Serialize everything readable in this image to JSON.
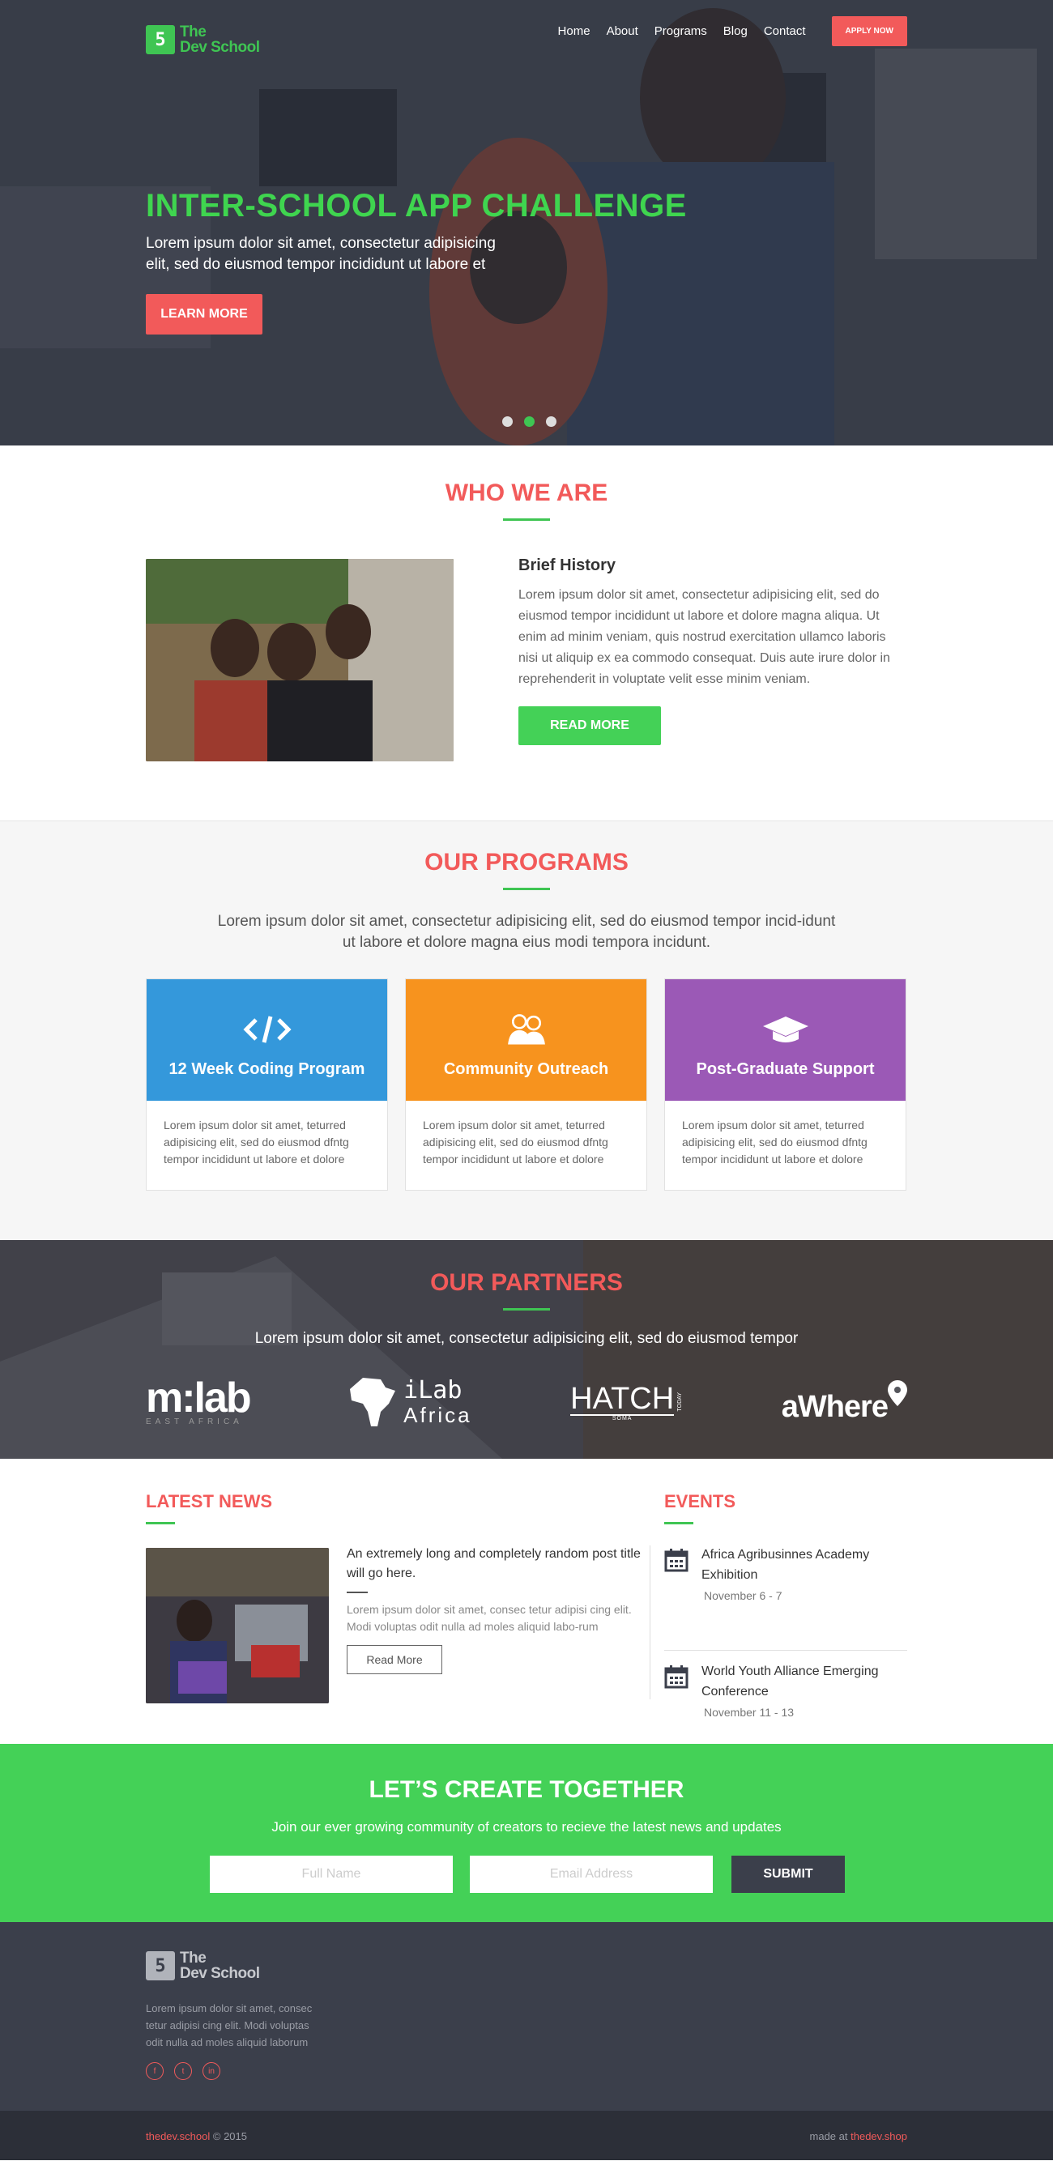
{
  "brand": {
    "line1": "The",
    "line2": "Dev School",
    "glyph": "5"
  },
  "nav": {
    "items": [
      "Home",
      "About",
      "Programs",
      "Blog",
      "Contact"
    ],
    "apply": "APPLY NOW"
  },
  "hero": {
    "title": "INTER-SCHOOL APP CHALLENGE",
    "subtitle": "Lorem ipsum dolor sit amet, consectetur adipisicing elit, sed do eiusmod tempor incididunt ut labore et",
    "button": "LEARN MORE",
    "slides": 3,
    "active_slide": 2
  },
  "who": {
    "title": "WHO WE ARE",
    "heading": "Brief History",
    "body": "Lorem ipsum dolor sit amet, consectetur adipisicing elit, sed do eiusmod tempor incididunt ut labore et dolore magna aliqua. Ut enim ad minim veniam, quis nostrud exercitation ullamco laboris nisi ut aliquip ex ea commodo consequat. Duis aute irure dolor in reprehenderit in voluptate velit esse minim veniam.",
    "button": "READ MORE"
  },
  "programs": {
    "title": "OUR PROGRAMS",
    "intro": "Lorem ipsum dolor sit amet, consectetur adipisicing elit, sed do eiusmod tempor incid-idunt ut labore et dolore magna eius modi tempora incidunt.",
    "cards": [
      {
        "title": "12 Week Coding Program",
        "icon": "code-icon",
        "color": "#3498db",
        "body": "Lorem ipsum dolor sit amet, teturred adipisicing elit, sed do eiusmod  dfntg tempor incididunt ut labore et dolore"
      },
      {
        "title": "Community Outreach",
        "icon": "people-icon",
        "color": "#f7931e",
        "body": "Lorem ipsum dolor sit amet, teturred adipisicing elit, sed do eiusmod  dfntg tempor incididunt ut labore et dolore"
      },
      {
        "title": "Post-Graduate Support",
        "icon": "graduation-cap-icon",
        "color": "#9b59b6",
        "body": "Lorem ipsum dolor sit amet, teturred adipisicing elit, sed do eiusmod  dfntg tempor incididunt ut labore et dolore"
      }
    ]
  },
  "partners": {
    "title": "OUR PARTNERS",
    "intro": "Lorem ipsum dolor sit amet, consectetur adipisicing elit, sed do eiusmod tempor",
    "logos": [
      {
        "name": "m:lab",
        "sub": "EAST AFRICA"
      },
      {
        "name": "iLab",
        "sub": "Africa"
      },
      {
        "name": "HATCH",
        "sub": "SOMA",
        "side": "TODAY"
      },
      {
        "name": "aWhere"
      }
    ]
  },
  "news": {
    "title": "LATEST NEWS",
    "post_title": "An extremely long and completely random post title will go here.",
    "post_body": "Lorem ipsum dolor sit amet, consec tetur adipisi cing elit. Modi voluptas odit nulla ad moles aliquid labo-rum",
    "button": "Read More"
  },
  "events": {
    "title": "EVENTS",
    "items": [
      {
        "name": "Africa Agribusinnes Academy Exhibition",
        "date": "November 6 - 7"
      },
      {
        "name": "World Youth Alliance Emerging Conference",
        "date": "November 11 - 13"
      }
    ]
  },
  "cta": {
    "title": "LET’S CREATE TOGETHER",
    "subtitle": "Join our ever growing community of creators to recieve the latest news and updates",
    "name_placeholder": "Full Name",
    "email_placeholder": "Email Address",
    "submit": "SUBMIT"
  },
  "footer": {
    "about": "Lorem ipsum dolor sit amet, consec tetur adipisi cing elit. Modi voluptas odit nulla ad moles aliquid laborum",
    "socials": [
      "f",
      "t",
      "in"
    ],
    "site": "thedev.school",
    "year": "© 2015",
    "made_at": "made at",
    "shop": "thedev.shop"
  },
  "colors": {
    "brand_green": "#3fc553",
    "accent_red": "#f25a5a",
    "dark": "#3b3f4b"
  }
}
